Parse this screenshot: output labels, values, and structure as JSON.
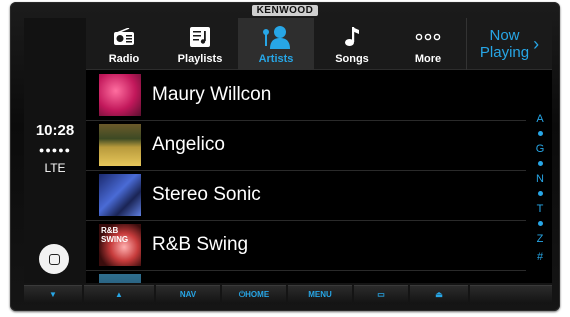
{
  "device": {
    "brand": "KENWOOD"
  },
  "status": {
    "time": "10:28",
    "signal": "●●●●●",
    "network": "LTE"
  },
  "tabs": [
    {
      "label": "Radio",
      "icon": "radio-icon"
    },
    {
      "label": "Playlists",
      "icon": "playlist-icon"
    },
    {
      "label": "Artists",
      "icon": "artist-icon",
      "active": true
    },
    {
      "label": "Songs",
      "icon": "music-note-icon"
    },
    {
      "label": "More",
      "icon": "more-dots-icon"
    }
  ],
  "now_playing": {
    "line1": "Now",
    "line2": "Playing",
    "chevron": "›"
  },
  "artists": [
    {
      "name": "Maury Willcon"
    },
    {
      "name": "Angelico"
    },
    {
      "name": "Stereo Sonic"
    },
    {
      "name": "R&B Swing",
      "cover_text": "R&B SWING"
    },
    {
      "name": ""
    }
  ],
  "index_letters": [
    "A",
    "G",
    "N",
    "T",
    "Z",
    "#"
  ],
  "hardware_buttons": [
    "▼",
    "▲",
    "NAV",
    "⏻HOME",
    "MENU",
    "▭",
    "⏏"
  ],
  "colors": {
    "accent": "#27a6e6",
    "background": "#000000",
    "tabbar": "#1a1a1a"
  }
}
